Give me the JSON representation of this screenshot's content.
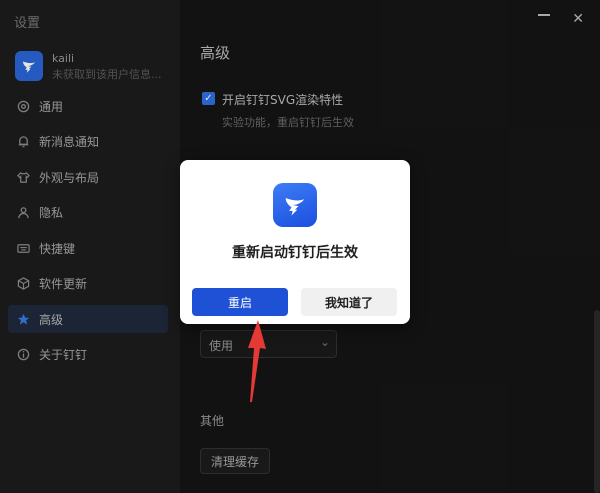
{
  "app": {
    "title": "设置"
  },
  "profile": {
    "name": "kaili",
    "subtitle": "未获取到该用户信息..."
  },
  "sidebar": {
    "items": [
      {
        "label": "通用",
        "icon": "settings-icon"
      },
      {
        "label": "新消息通知",
        "icon": "bell-icon"
      },
      {
        "label": "外观与布局",
        "icon": "shirt-icon"
      },
      {
        "label": "隐私",
        "icon": "person-icon"
      },
      {
        "label": "快捷键",
        "icon": "keyboard-icon"
      },
      {
        "label": "软件更新",
        "icon": "cube-icon"
      },
      {
        "label": "高级",
        "icon": "star-icon",
        "active": true
      },
      {
        "label": "关于钉钉",
        "icon": "info-icon"
      }
    ]
  },
  "main": {
    "section_title": "高级",
    "svg_option": {
      "label": "开启钉钉SVG渲染特性",
      "description": "实验功能，重启钉钉后生效",
      "checked": true
    },
    "select": {
      "value": "使用"
    },
    "other_title": "其他",
    "clear_cache_label": "清理缓存"
  },
  "modal": {
    "message": "重新启动钉钉后生效",
    "restart_label": "重启",
    "ok_label": "我知道了"
  },
  "colors": {
    "accent": "#1e51d6",
    "sidebar_bg": "#1c1c1c",
    "main_bg": "#151515",
    "arrow": "#e53935"
  }
}
